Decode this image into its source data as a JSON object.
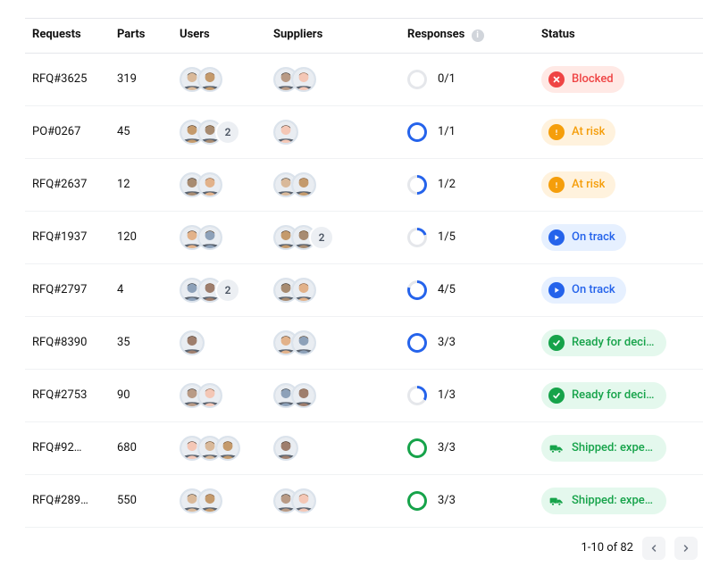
{
  "columns": {
    "requests": "Requests",
    "parts": "Parts",
    "users": "Users",
    "suppliers": "Suppliers",
    "responses": "Responses",
    "status": "Status"
  },
  "status_labels": {
    "blocked": "Blocked",
    "atrisk": "At risk",
    "ontrack": "On track",
    "ready": "Ready for decision",
    "shipped": "Shipped: expected for…"
  },
  "colors": {
    "blocked": "#ef4444",
    "atrisk": "#f59e0b",
    "ontrack": "#2563eb",
    "ready": "#16a34a",
    "shipped": "#16a34a",
    "ring_empty": "#e5e7eb"
  },
  "rows": [
    {
      "request": "RFQ#3625",
      "parts": "319",
      "user_count": 2,
      "supplier_count": 2,
      "responses": {
        "done": 0,
        "total": 1,
        "text": "0/1"
      },
      "status": "blocked"
    },
    {
      "request": "PO#0267",
      "parts": "45",
      "user_count": 2,
      "user_more": "2",
      "supplier_count": 1,
      "responses": {
        "done": 1,
        "total": 1,
        "text": "1/1"
      },
      "status": "atrisk"
    },
    {
      "request": "RFQ#2637",
      "parts": "12",
      "user_count": 2,
      "supplier_count": 2,
      "responses": {
        "done": 1,
        "total": 2,
        "text": "1/2"
      },
      "status": "atrisk"
    },
    {
      "request": "RFQ#1937",
      "parts": "120",
      "user_count": 2,
      "supplier_count": 2,
      "supplier_more": "2",
      "responses": {
        "done": 1,
        "total": 5,
        "text": "1/5"
      },
      "status": "ontrack"
    },
    {
      "request": "RFQ#2797",
      "parts": "4",
      "user_count": 2,
      "user_more": "2",
      "supplier_count": 2,
      "responses": {
        "done": 4,
        "total": 5,
        "text": "4/5"
      },
      "status": "ontrack"
    },
    {
      "request": "RFQ#8390",
      "parts": "35",
      "user_count": 1,
      "supplier_count": 2,
      "responses": {
        "done": 3,
        "total": 3,
        "text": "3/3"
      },
      "status": "ready"
    },
    {
      "request": "RFQ#2753",
      "parts": "90",
      "user_count": 2,
      "supplier_count": 2,
      "responses": {
        "done": 1,
        "total": 3,
        "text": "1/3"
      },
      "status": "ready"
    },
    {
      "request": "RFQ#92…",
      "parts": "680",
      "user_count": 3,
      "supplier_count": 1,
      "responses": {
        "done": 3,
        "total": 3,
        "text": "3/3"
      },
      "status": "shipped"
    },
    {
      "request": "RFQ#289…",
      "parts": "550",
      "user_count": 2,
      "supplier_count": 2,
      "responses": {
        "done": 3,
        "total": 3,
        "text": "3/3"
      },
      "status": "shipped"
    }
  ],
  "pagination": {
    "label": "1-10 of 82"
  },
  "avatar_palette": [
    "#f4c7b6",
    "#d9b99a",
    "#c49a6c",
    "#a78b71",
    "#e2b28a",
    "#8da1b9",
    "#9e7e6d",
    "#b89a85"
  ]
}
